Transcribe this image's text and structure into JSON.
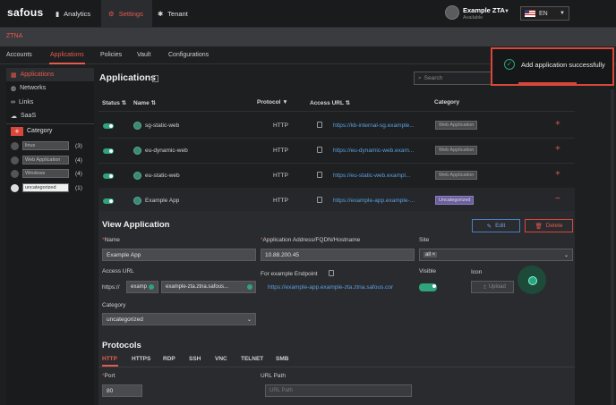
{
  "topbar": {
    "logo": "safous",
    "nav": [
      {
        "label": "Analytics",
        "icon": "bar-chart-icon"
      },
      {
        "label": "Settings",
        "icon": "gear-icon",
        "active": true
      },
      {
        "label": "Tenant",
        "icon": "palette-icon"
      }
    ],
    "user": {
      "name": "Example ZTA",
      "status": "Available"
    },
    "language": "EN"
  },
  "breadcrumb": "ZTNA",
  "subnav": {
    "tabs": [
      "Accounts",
      "Applications",
      "Policies",
      "Vault",
      "Configurations"
    ],
    "active": "Applications"
  },
  "sidebar": {
    "items": [
      "Applications",
      "Networks",
      "Links",
      "SaaS"
    ],
    "category_title": "Category",
    "add_label": "+",
    "categories": [
      {
        "name": "linux",
        "count": "(3)"
      },
      {
        "name": "Web Application",
        "count": "(4)"
      },
      {
        "name": "Windows",
        "count": "(4)"
      },
      {
        "name": "uncategorized",
        "count": "(1)"
      }
    ]
  },
  "main": {
    "title": "Applications",
    "search_placeholder": "Search",
    "columns": [
      "Status",
      "Name",
      "Protocol",
      "Access URL",
      "Category"
    ],
    "rows": [
      {
        "name": "sg-static-web",
        "protocol": "HTTP",
        "url": "https://kb-internal-sg.example...",
        "category": "Web Application"
      },
      {
        "name": "eu-dynamic-web",
        "protocol": "HTTP",
        "url": "https://eu-dynamic-web.exam...",
        "category": "Web Application"
      },
      {
        "name": "eu-static-web",
        "protocol": "HTTP",
        "url": "https://eu-static-web.exampl...",
        "category": "Web Application"
      },
      {
        "name": "Example App",
        "protocol": "HTTP",
        "url": "https://example-app.example-...",
        "category": "Uncategorized"
      }
    ]
  },
  "view": {
    "title": "View Application",
    "edit_label": "Edit",
    "delete_label": "Delete",
    "name_label": "Name",
    "name_value": "Example App",
    "address_label": "Application Address/FQDN/Hostname",
    "address_value": "10.88.200.45",
    "site_label": "Site",
    "site_value": "all",
    "access_url_label": "Access URL",
    "access_prefix": "https://",
    "access_sub": "examp",
    "access_domain": "example-zta.ztna.safous...",
    "endpoint_label": "For example Endpoint",
    "endpoint_value": "https://example-app.example-zta.ztna.safous.cor",
    "visible_label": "Visible",
    "icon_label": "Icon",
    "upload_label": "Upload",
    "category_label": "Category",
    "category_value": "uncategorized"
  },
  "protocols": {
    "title": "Protocols",
    "tabs": [
      "HTTP",
      "HTTPS",
      "RDP",
      "SSH",
      "VNC",
      "TELNET",
      "SMB"
    ],
    "port_label": "Port",
    "port_value": "80",
    "path_label": "URL Path",
    "path_placeholder": "URL Path"
  },
  "toast": {
    "message": "Add application successfully"
  }
}
